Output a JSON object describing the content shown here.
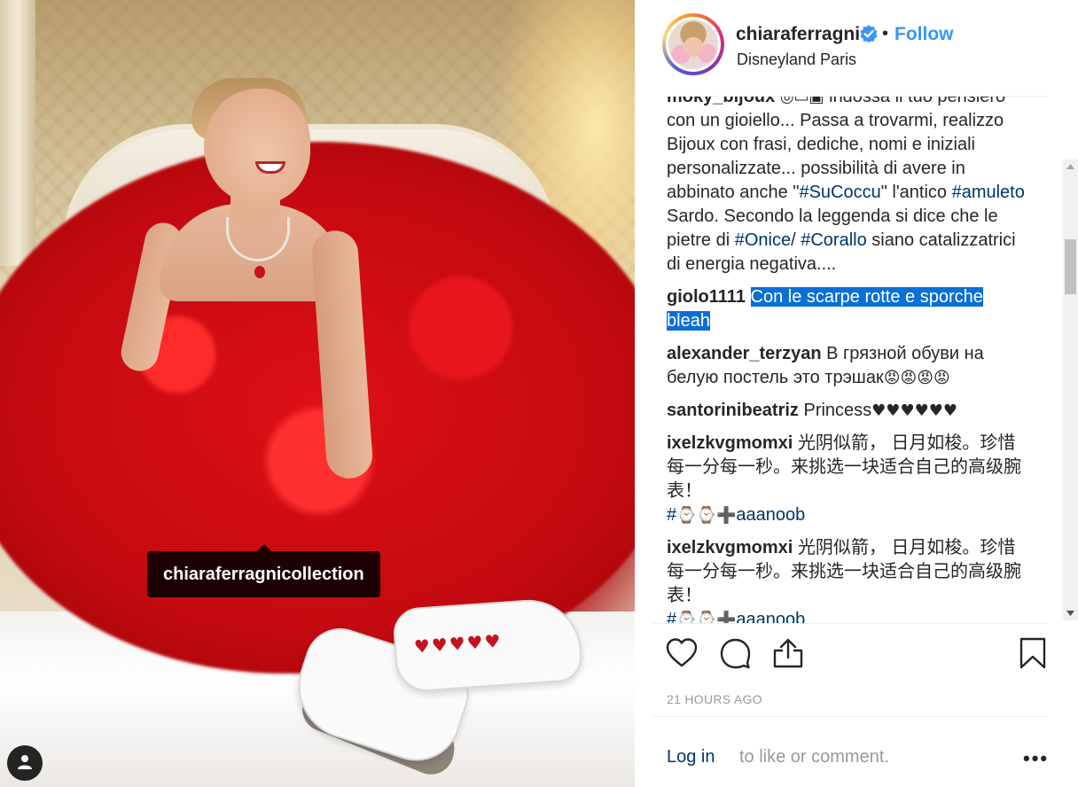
{
  "photo": {
    "tag_label": "chiaraferragnicollection",
    "user_tag_icon": "person-icon"
  },
  "post_header": {
    "username": "chiaraferragni",
    "verified_icon": "verified-badge-icon",
    "separator": "•",
    "follow_label": "Follow",
    "location": "Disneyland Paris"
  },
  "comments": [
    {
      "user": "moky_bijoux",
      "parts": [
        {
          "t": "text",
          "v": " "
        },
        {
          "t": "emoji",
          "v": "◎▭▣"
        },
        {
          "t": "text",
          "v": " indossa il tuo pensiero con un gioiello... Passa a trovarmi, realizzo Bijoux con frasi, dediche, nomi e iniziali personalizzate... possibilità di avere in abbinato anche \""
        },
        {
          "t": "tag",
          "v": "#SuCoccu"
        },
        {
          "t": "text",
          "v": "\" l'antico "
        },
        {
          "t": "tag",
          "v": "#amuleto"
        },
        {
          "t": "text",
          "v": " Sardo. Secondo la leggenda si dice che le pietre di "
        },
        {
          "t": "tag",
          "v": "#Onice"
        },
        {
          "t": "text",
          "v": "/ "
        },
        {
          "t": "tag",
          "v": "#Corallo"
        },
        {
          "t": "text",
          "v": " siano catalizzatrici di energia negativa...."
        }
      ]
    },
    {
      "user": "giolo1111",
      "parts": [
        {
          "t": "text",
          "v": " "
        },
        {
          "t": "selected",
          "v": "Con le scarpe rotte e sporche bleah"
        }
      ]
    },
    {
      "user": "alexander_terzyan",
      "parts": [
        {
          "t": "text",
          "v": " В грязной обуви на белую постель это трэшак"
        },
        {
          "t": "emoji",
          "v": "😡😡😡😡"
        }
      ]
    },
    {
      "user": "santorinibeatriz",
      "parts": [
        {
          "t": "text",
          "v": " Princess"
        },
        {
          "t": "emoji",
          "v": "♥♥♥♥♥♥"
        }
      ]
    },
    {
      "user": "ixelzkvgmomxi",
      "parts": [
        {
          "t": "text",
          "v": " 光阴似箭， 日月如梭。珍惜每一分每一秒。来挑选一块适合自己的高级腕表！"
        },
        {
          "t": "br",
          "v": ""
        },
        {
          "t": "tag",
          "v": "#"
        },
        {
          "t": "emoji",
          "v": "⌚⌚➕"
        },
        {
          "t": "tag",
          "v": "aaanoob"
        }
      ]
    },
    {
      "user": "ixelzkvgmomxi",
      "parts": [
        {
          "t": "text",
          "v": " 光阴似箭， 日月如梭。珍惜每一分每一秒。来挑选一块适合自己的高级腕表！"
        },
        {
          "t": "br",
          "v": ""
        },
        {
          "t": "tag",
          "v": "#"
        },
        {
          "t": "emoji",
          "v": "⌚⌚➕"
        },
        {
          "t": "tag",
          "v": "aaanoob"
        }
      ]
    }
  ],
  "actions": {
    "like_icon": "heart-icon",
    "comment_icon": "comment-bubble-icon",
    "share_icon": "share-icon",
    "save_icon": "bookmark-icon"
  },
  "timestamp": "21 HOURS AGO",
  "login": {
    "link_label": "Log in",
    "rest_text": " to like or comment."
  },
  "more_label": "•••",
  "colors": {
    "link_blue": "#3897f0",
    "hashtag": "#003569",
    "selection": "#0a6fd6",
    "muted": "#999999"
  }
}
